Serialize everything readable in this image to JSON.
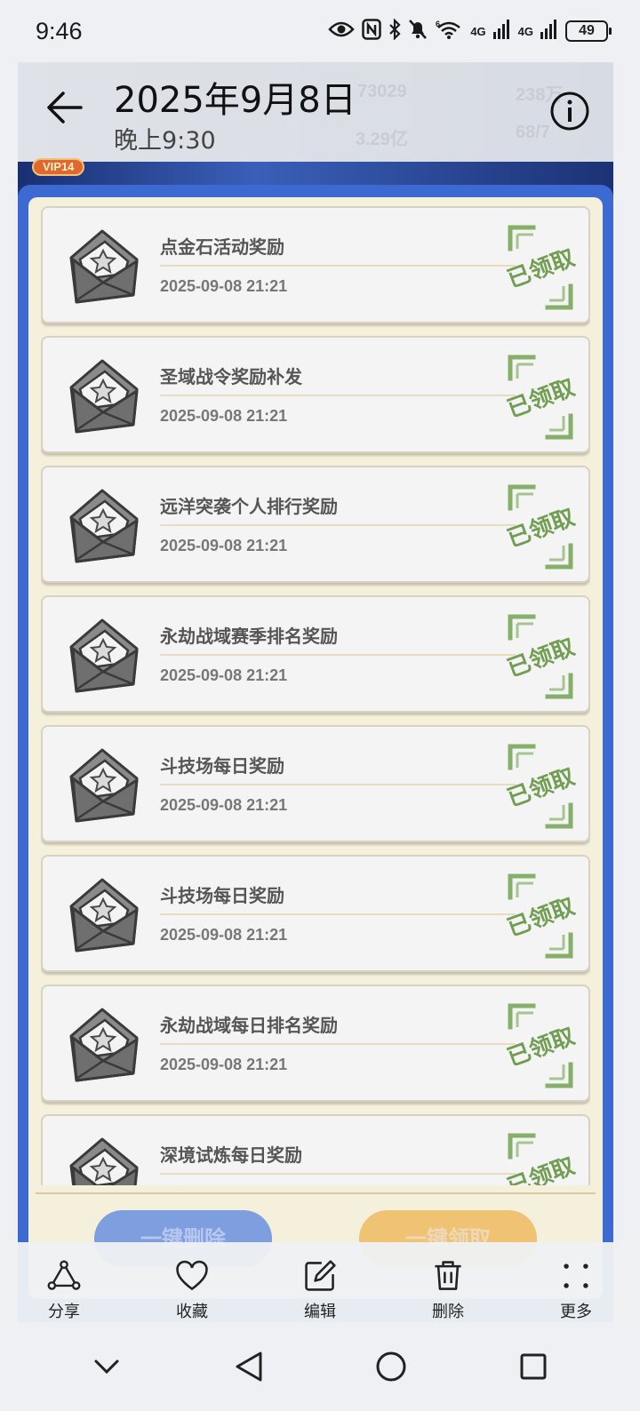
{
  "status_bar": {
    "time": "9:46",
    "net1": "4G",
    "net2": "4G",
    "wifi_label": "6",
    "battery": "49"
  },
  "background_game": {
    "stat1": "73029",
    "stat2": "238万",
    "stat3": "3.29亿",
    "stat4": "68/7",
    "vip": "VIP14"
  },
  "header": {
    "title": "2025年9月8日",
    "subtitle": "晚上9:30"
  },
  "mail_list": {
    "stamp_text": "已领取",
    "items": [
      {
        "title": "点金石活动奖励",
        "date": "2025-09-08 21:21"
      },
      {
        "title": "圣域战令奖励补发",
        "date": "2025-09-08 21:21"
      },
      {
        "title": "远洋突袭个人排行奖励",
        "date": "2025-09-08 21:21"
      },
      {
        "title": "永劫战域赛季排名奖励",
        "date": "2025-09-08 21:21"
      },
      {
        "title": "斗技场每日奖励",
        "date": "2025-09-08 21:21"
      },
      {
        "title": "斗技场每日奖励",
        "date": "2025-09-08 21:21"
      },
      {
        "title": "永劫战域每日排名奖励",
        "date": "2025-09-08 21:21"
      },
      {
        "title": "深境试炼每日奖励",
        "date": ""
      }
    ]
  },
  "panel_buttons": {
    "delete_all": "一键删除",
    "claim_all": "一键领取"
  },
  "action_bar": {
    "share": "分享",
    "favorite": "收藏",
    "edit": "编辑",
    "delete": "删除",
    "more": "更多"
  },
  "colors": {
    "accent_blue": "#3c6ad2",
    "panel_cream": "#f5f0dc",
    "stamp_green": "#6b9a4a"
  }
}
